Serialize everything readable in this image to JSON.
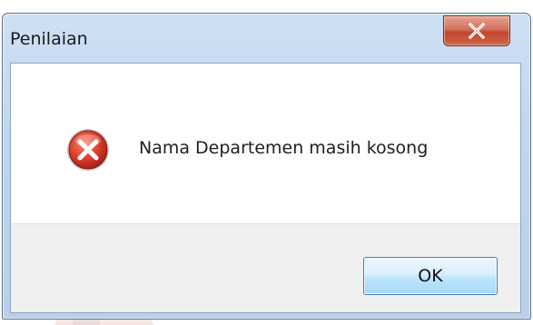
{
  "dialog": {
    "title": "Penilaian",
    "close_icon": "close-icon",
    "status_icon": "error-icon",
    "message": "Nama Departemen masih kosong",
    "ok_label": "OK"
  },
  "colors": {
    "close_button": "#c7452f",
    "error_icon": "#d83b2b",
    "ok_button_border": "#3c7fb1"
  }
}
